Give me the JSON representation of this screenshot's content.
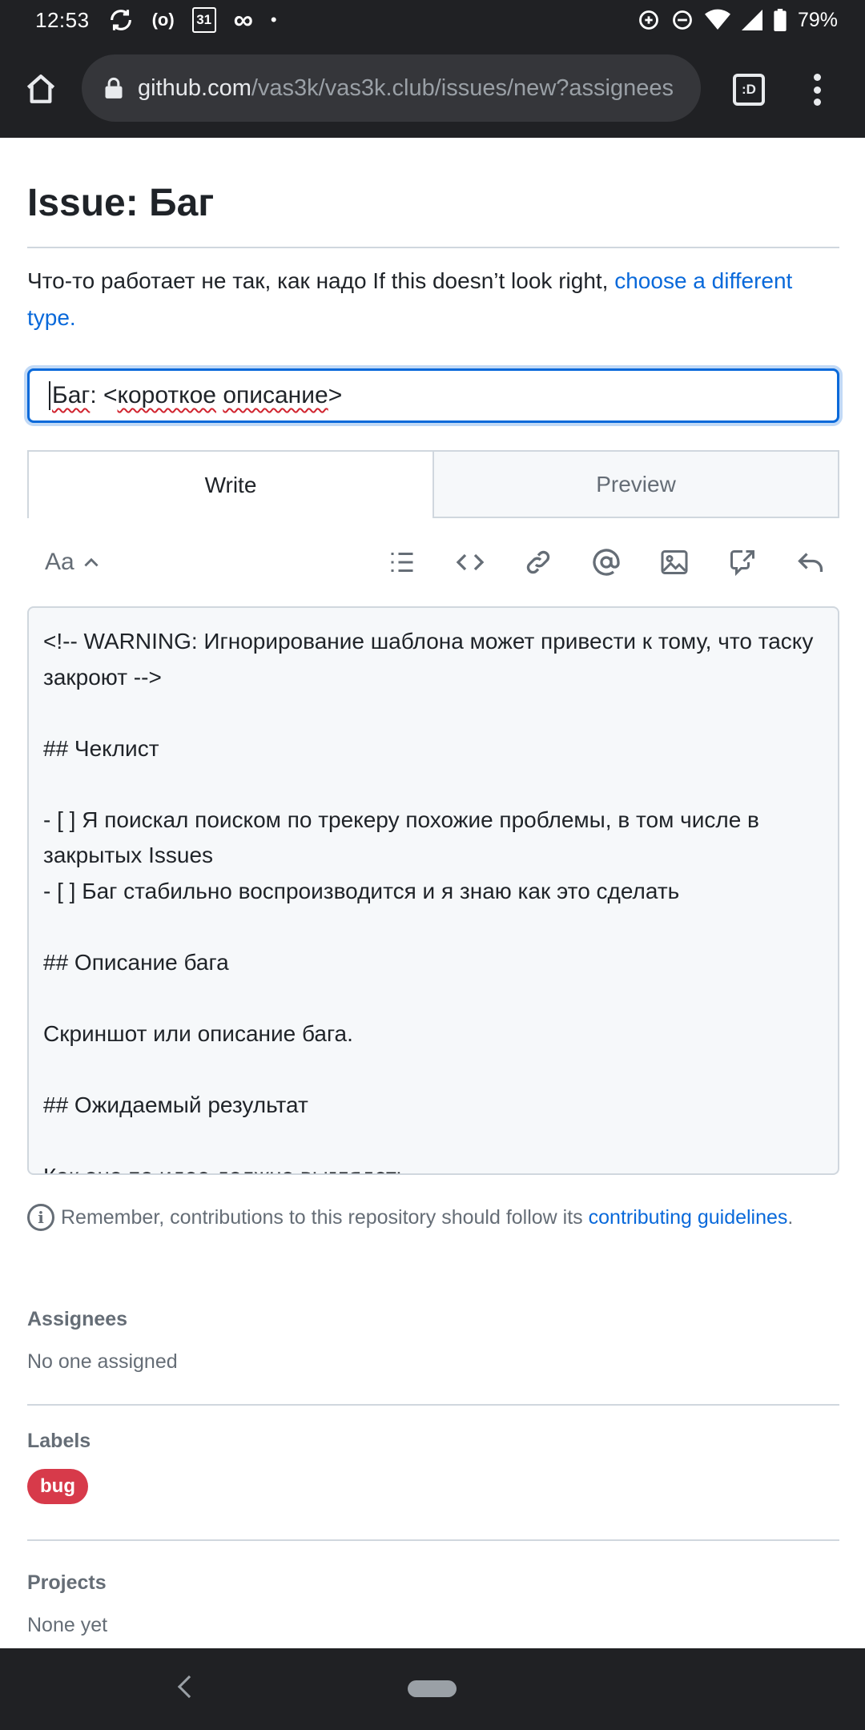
{
  "status_bar": {
    "time": "12:53",
    "battery": "79%",
    "calendar_day": "31"
  },
  "browser": {
    "url_domain": "github.com",
    "url_path": "/vas3k/vas3k.club/issues/new?assignees",
    "tabs_label": ":D"
  },
  "page": {
    "title": "Issue: Баг",
    "description": "Что-то работает не так, как надо If this doesn’t look right, ",
    "description_link": "choose a different type.",
    "title_input": {
      "word1": "Баг",
      "colon": ": <",
      "word2": "короткое",
      "word3": "описание",
      "end": ">"
    },
    "tabs": {
      "write": "Write",
      "preview": "Preview"
    },
    "format_label": "Aa",
    "editor_text": "<!-- WARNING: Игнорирование шаблона может привести к тому, что таску закроют -->\n\n## Чеклист\n\n- [ ] Я поискал поиском по трекеру похожие проблемы, в том числе в закрытых Issues\n- [ ] Баг стабильно воспроизводится и я знаю как это сделать\n\n## Описание бага\n\nСкриншот или описание бага.\n\n## Ожидаемый результат\n\nКак оно по идее должно выглядеть",
    "note_text": "Remember, contributions to this repository should follow its ",
    "note_link": "contributing guidelines",
    "note_end": ".",
    "assignees": {
      "heading": "Assignees",
      "value": "No one assigned"
    },
    "labels": {
      "heading": "Labels",
      "bug": "bug"
    },
    "projects": {
      "heading": "Projects",
      "value": "None yet"
    }
  },
  "colors": {
    "link": "#0969da",
    "bug_label": "#d73a4a",
    "chrome_dark": "#202124"
  }
}
